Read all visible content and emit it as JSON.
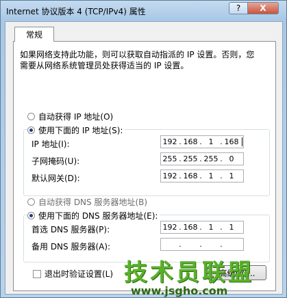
{
  "window": {
    "title": "Internet 协议版本 4 (TCP/IPv4) 属性",
    "help_label": "?",
    "close_label": "X"
  },
  "tab": {
    "label": "常规"
  },
  "intro_text": "如果网络支持此功能，则可以获取自动指派的 IP 设置。否则，您需要从网络系统管理员处获得适当的 IP 设置。",
  "ip_section": {
    "auto_label": "自动获得 IP 地址(O)",
    "auto_selected": false,
    "manual_label": "使用下面的 IP 地址(S):",
    "manual_selected": true,
    "fields": [
      {
        "label": "IP 地址(I):",
        "octets": [
          "192",
          "168",
          "1",
          "168"
        ]
      },
      {
        "label": "子网掩码(U):",
        "octets": [
          "255",
          "255",
          "255",
          "0"
        ]
      },
      {
        "label": "默认网关(D):",
        "octets": [
          "192",
          "168",
          "1",
          "1"
        ]
      }
    ]
  },
  "dns_section": {
    "auto_label": "自动获得 DNS 服务器地址(B)",
    "auto_selected": false,
    "manual_label": "使用下面的 DNS 服务器地址(E):",
    "manual_selected": true,
    "fields": [
      {
        "label": "首选 DNS 服务器(P):",
        "octets": [
          "192",
          "168",
          "1",
          "1"
        ]
      },
      {
        "label": "备用 DNS 服务器(A):",
        "octets": [
          "",
          "",
          "",
          ""
        ]
      }
    ]
  },
  "validate_on_exit": {
    "label": "退出时验证设置(L)",
    "checked": false
  },
  "advanced_button": {
    "label": "高级(V)..."
  },
  "watermark": {
    "title": "技术员联盟",
    "url": "www.jsgho.com"
  }
}
